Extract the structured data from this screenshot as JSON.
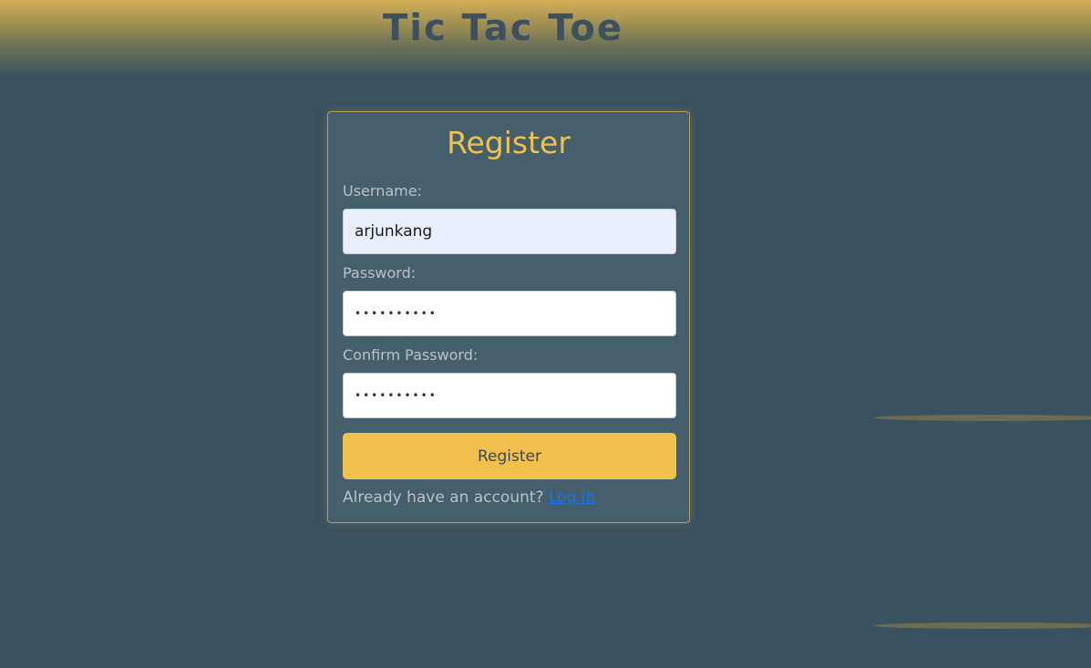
{
  "header": {
    "title": "Tic Tac Toe"
  },
  "register_form": {
    "title": "Register",
    "username": {
      "label": "Username:",
      "value": "arjunkang"
    },
    "password": {
      "label": "Password:",
      "value": "••••••••••"
    },
    "confirm_password": {
      "label": "Confirm Password:",
      "value": "••••••••••"
    },
    "submit_label": "Register",
    "footer_text": "Already have an account?",
    "login_link_label": "Log in"
  },
  "colors": {
    "background": "#3a515f",
    "card_background": "#455f6c",
    "accent": "#f2c04c",
    "link": "#1a73e8",
    "header_gradient_top": "#d4af57"
  }
}
